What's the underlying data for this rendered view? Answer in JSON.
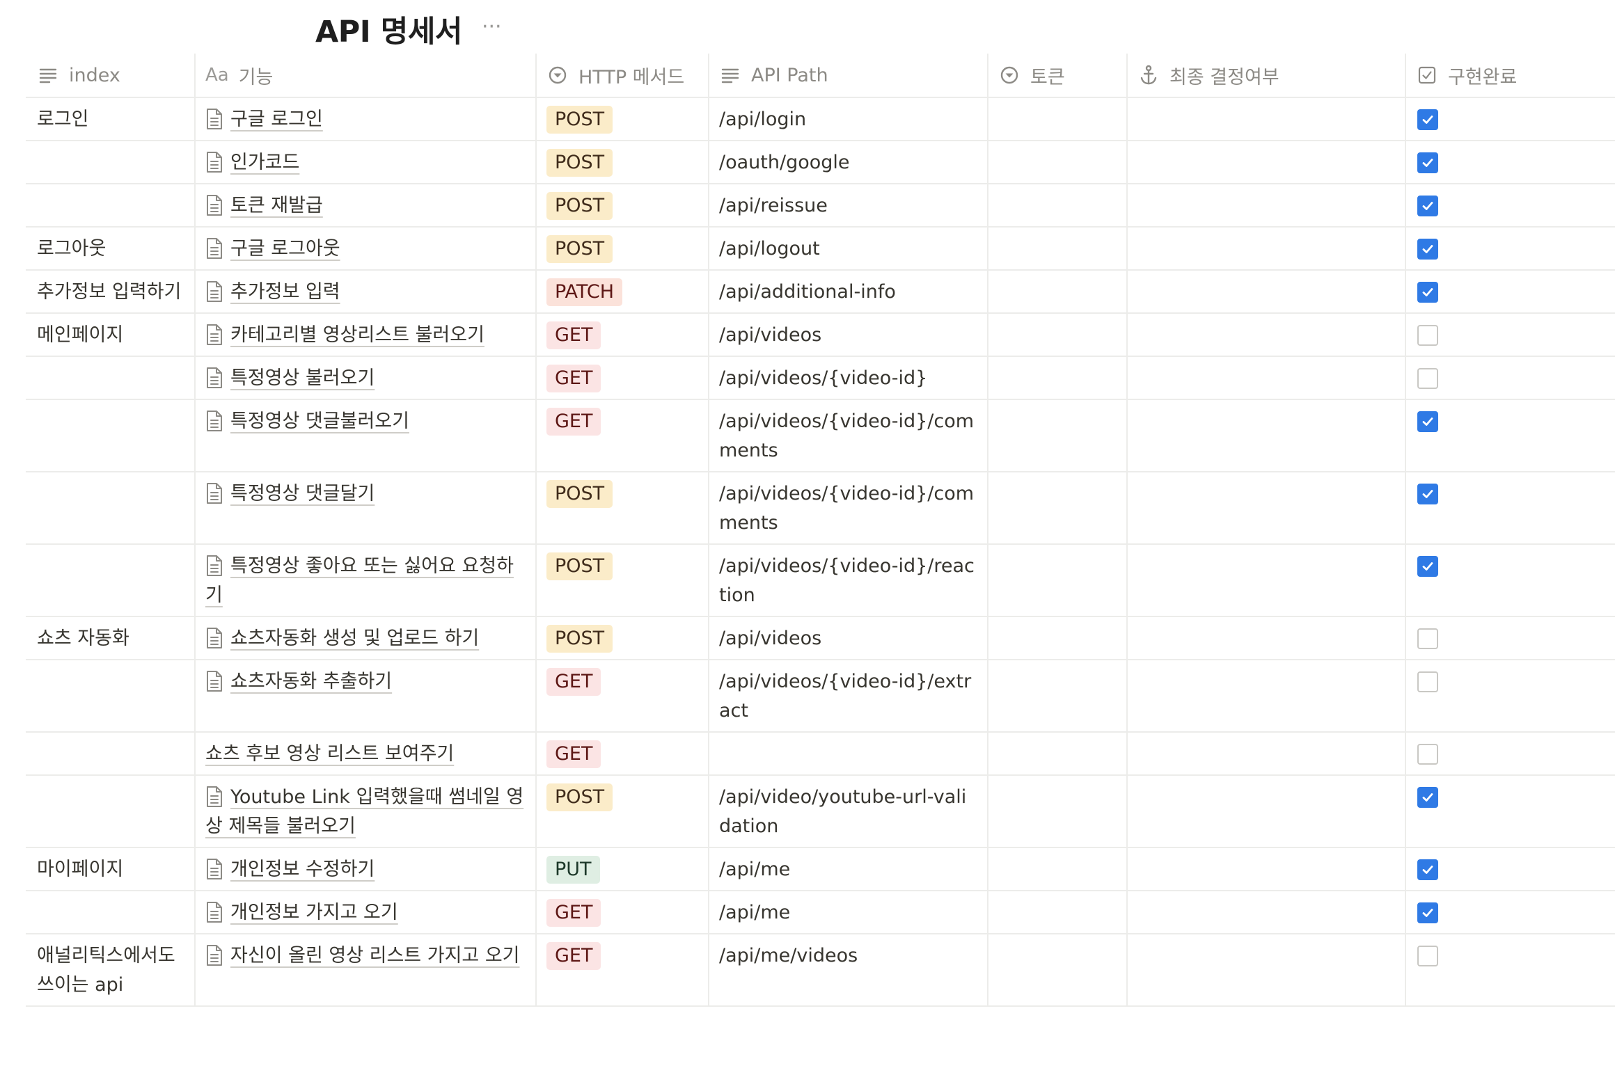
{
  "page": {
    "title": "API 명세서",
    "more_icon": "more-horizontal-icon"
  },
  "columns": [
    {
      "label": "index",
      "icon": "text-lines-icon"
    },
    {
      "label": "기능",
      "icon": "title-aa-icon",
      "icon_text": "Aa"
    },
    {
      "label": "HTTP 메서드",
      "icon": "select-circle-icon"
    },
    {
      "label": "API Path",
      "icon": "text-lines-icon"
    },
    {
      "label": "토큰",
      "icon": "select-circle-icon"
    },
    {
      "label": "최종 결정여부",
      "icon": "anchor-icon"
    },
    {
      "label": "구현완료",
      "icon": "checkbox-icon"
    }
  ],
  "method_colors": {
    "POST": "#fbecc9",
    "GET": "#fbe4e4",
    "PATCH": "#fbe2da",
    "PUT": "#dfeee3",
    "checkbox_checked": "#2f7ae5"
  },
  "rows": [
    {
      "index": "로그인",
      "func": "구글 로그인",
      "has_icon": true,
      "method": "POST",
      "path": "/api/login",
      "token": "",
      "final": "",
      "done": true
    },
    {
      "index": "",
      "func": "인가코드",
      "has_icon": true,
      "method": "POST",
      "path": "/oauth/google",
      "token": "",
      "final": "",
      "done": true
    },
    {
      "index": "",
      "func": "토큰 재발급",
      "has_icon": true,
      "method": "POST",
      "path": "/api/reissue",
      "token": "",
      "final": "",
      "done": true
    },
    {
      "index": "로그아웃",
      "func": "구글 로그아웃",
      "has_icon": true,
      "method": "POST",
      "path": "/api/logout",
      "token": "",
      "final": "",
      "done": true
    },
    {
      "index": "추가정보 입력하기",
      "func": "추가정보 입력",
      "has_icon": true,
      "method": "PATCH",
      "path": "/api/additional-info",
      "token": "",
      "final": "",
      "done": true
    },
    {
      "index": "메인페이지",
      "func": "카테고리별 영상리스트 불러오기",
      "has_icon": true,
      "method": "GET",
      "path": "/api/videos",
      "token": "",
      "final": "",
      "done": false
    },
    {
      "index": "",
      "func": "특정영상 불러오기",
      "has_icon": true,
      "method": "GET",
      "path": "/api/videos/{video-id}",
      "token": "",
      "final": "",
      "done": false
    },
    {
      "index": "",
      "func": "특정영상 댓글불러오기",
      "has_icon": true,
      "method": "GET",
      "path": "/api/videos/{video-id}/comments",
      "token": "",
      "final": "",
      "done": true
    },
    {
      "index": "",
      "func": "특정영상 댓글달기",
      "has_icon": true,
      "method": "POST",
      "path": "/api/videos/{video-id}/comments",
      "token": "",
      "final": "",
      "done": true
    },
    {
      "index": "",
      "func": "특정영상 좋아요 또는 싫어요 요청하기",
      "has_icon": true,
      "method": "POST",
      "path": "/api/videos/{video-id}/reaction",
      "token": "",
      "final": "",
      "done": true
    },
    {
      "index": "쇼츠 자동화",
      "func": "쇼츠자동화 생성 및 업로드 하기",
      "has_icon": true,
      "method": "POST",
      "path": "/api/videos",
      "token": "",
      "final": "",
      "done": false
    },
    {
      "index": "",
      "func": "쇼츠자동화 추출하기",
      "has_icon": true,
      "method": "GET",
      "path": "/api/videos/{video-id}/extract",
      "token": "",
      "final": "",
      "done": false
    },
    {
      "index": "",
      "func": "쇼츠 후보 영상 리스트 보여주기",
      "has_icon": false,
      "method": "GET",
      "path": "",
      "token": "",
      "final": "",
      "done": false
    },
    {
      "index": "",
      "func": "Youtube Link 입력했을때 썸네일 영상 제목들 불러오기",
      "has_icon": true,
      "method": "POST",
      "path": "/api/video/youtube-url-validation",
      "token": "",
      "final": "",
      "done": true
    },
    {
      "index": "마이페이지",
      "func": "개인정보 수정하기",
      "has_icon": true,
      "method": "PUT",
      "path": "/api/me",
      "token": "",
      "final": "",
      "done": true
    },
    {
      "index": "",
      "func": "개인정보 가지고 오기",
      "has_icon": true,
      "method": "GET",
      "path": "/api/me",
      "token": "",
      "final": "",
      "done": true
    },
    {
      "index": "애널리틱스에서도 쓰이는 api",
      "func": "자신이 올린 영상 리스트 가지고 오기",
      "has_icon": true,
      "method": "GET",
      "path": "/api/me/videos",
      "token": "",
      "final": "",
      "done": false
    }
  ]
}
